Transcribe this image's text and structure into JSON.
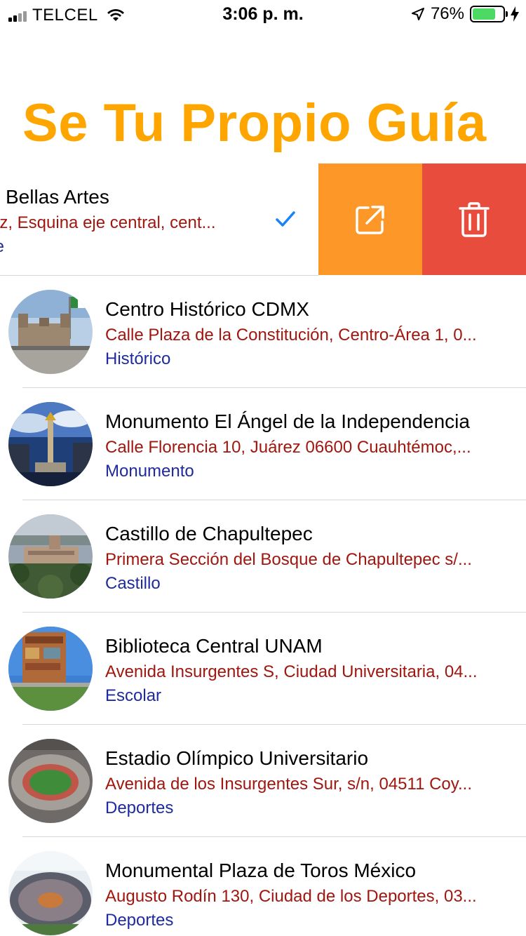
{
  "status_bar": {
    "carrier": "TELCEL",
    "time": "3:06 p. m.",
    "battery": "76%",
    "battery_level": 0.76
  },
  "title": "Se Tu Propio Guía",
  "swiped_row": {
    "name": "Bellas Artes",
    "address": "rez, Esquina eje central, cent...",
    "category": "rte"
  },
  "colors": {
    "title": "#ffa500",
    "share_action": "#fd9727",
    "delete_action": "#e74c3c",
    "address_text": "#a0170f",
    "category_text": "#1d2b9e",
    "checkmark": "#1a82fb"
  },
  "places": [
    {
      "name": "Centro Histórico CDMX",
      "address": "Calle Plaza de la Constitución, Centro-Área 1, 0...",
      "category": "Histórico"
    },
    {
      "name": "Monumento El Ángel de la Independencia",
      "address": "Calle Florencia 10, Juárez 06600 Cuauhtémoc,...",
      "category": "Monumento"
    },
    {
      "name": "Castillo de Chapultepec",
      "address": "Primera Sección del Bosque de Chapultepec s/...",
      "category": "Castillo"
    },
    {
      "name": "Biblioteca Central UNAM",
      "address": "Avenida Insurgentes S, Ciudad Universitaria, 04...",
      "category": "Escolar"
    },
    {
      "name": "Estadio Olímpico Universitario",
      "address": "Avenida de los Insurgentes Sur, s/n, 04511 Coy...",
      "category": "Deportes"
    },
    {
      "name": "Monumental Plaza de Toros México",
      "address": "Augusto Rodín 130, Ciudad de los Deportes, 03...",
      "category": "Deportes"
    }
  ]
}
